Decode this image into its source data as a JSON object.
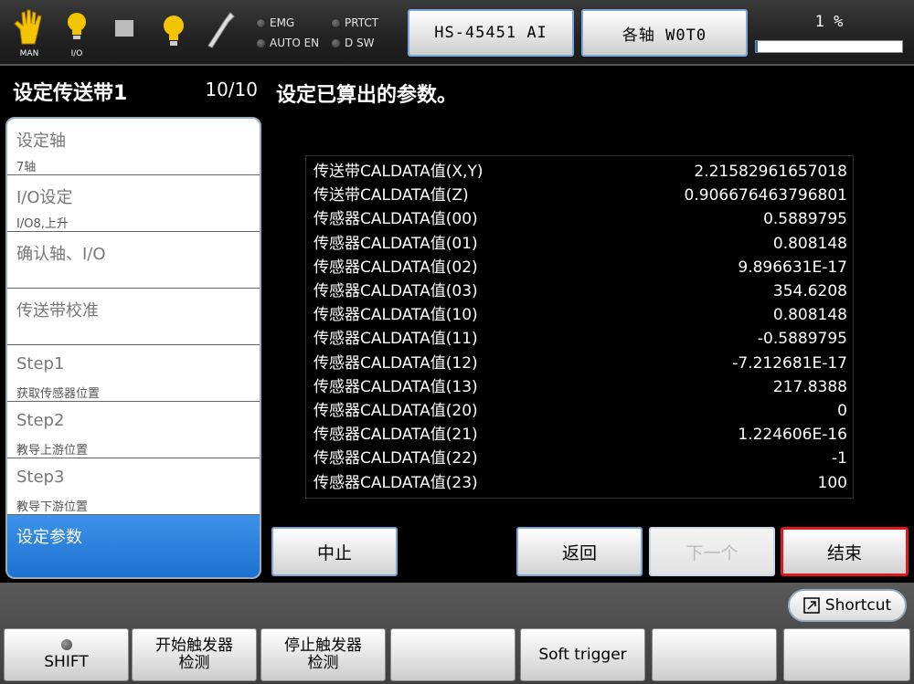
{
  "topbar": {
    "mode_label": "MAN",
    "io_label": "I/O",
    "lamps": [
      {
        "label": "EMG"
      },
      {
        "label": "PRTCT"
      },
      {
        "label": "AUTO EN"
      },
      {
        "label": "D SW"
      }
    ],
    "robot_button": "HS-45451 AI",
    "axis_button": "各轴 W0T0",
    "speed_label": "1 %",
    "speed_percent": 1,
    "icons": [
      "hand-icon",
      "bulb-icon",
      "square-icon",
      "bulb-icon",
      "wrench-icon"
    ]
  },
  "left": {
    "title": "设定传送带1",
    "counter": "10/10",
    "steps": [
      {
        "label": "设定轴",
        "sub": "7轴"
      },
      {
        "label": "I/O设定",
        "sub": "I/O8,上升"
      },
      {
        "label": "确认轴、I/O",
        "sub": ""
      },
      {
        "label": "传送带校准",
        "sub": ""
      },
      {
        "label": "Step1",
        "sub": "获取传感器位置"
      },
      {
        "label": "Step2",
        "sub": "教导上游位置"
      },
      {
        "label": "Step3",
        "sub": "教导下游位置"
      },
      {
        "label": "设定参数",
        "sub": ""
      }
    ],
    "active_index": 7
  },
  "main": {
    "title": "设定已算出的参数。",
    "params": [
      {
        "name": "传送带CALDATA值(X,Y)",
        "value": "2.21582961657018"
      },
      {
        "name": "传送带CALDATA值(Z)",
        "value": "0.906676463796801"
      },
      {
        "name": "传感器CALDATA值(00)",
        "value": "0.5889795"
      },
      {
        "name": "传感器CALDATA值(01)",
        "value": "0.808148"
      },
      {
        "name": "传感器CALDATA值(02)",
        "value": "9.896631E-17"
      },
      {
        "name": "传感器CALDATA值(03)",
        "value": "354.6208"
      },
      {
        "name": "传感器CALDATA值(10)",
        "value": "0.808148"
      },
      {
        "name": "传感器CALDATA值(11)",
        "value": "-0.5889795"
      },
      {
        "name": "传感器CALDATA值(12)",
        "value": "-7.212681E-17"
      },
      {
        "name": "传感器CALDATA值(13)",
        "value": "217.8388"
      },
      {
        "name": "传感器CALDATA值(20)",
        "value": "0"
      },
      {
        "name": "传感器CALDATA值(21)",
        "value": "1.224606E-16"
      },
      {
        "name": "传感器CALDATA值(22)",
        "value": "-1"
      },
      {
        "name": "传感器CALDATA值(23)",
        "value": "100"
      }
    ],
    "buttons": {
      "abort": "中止",
      "back": "返回",
      "next": "下一个",
      "finish": "结束"
    }
  },
  "bottom": {
    "shortcut": "Shortcut",
    "keys": [
      "SHIFT",
      "开始触发器\n检测",
      "停止触发器\n检测",
      "",
      "Soft trigger",
      "",
      ""
    ]
  }
}
